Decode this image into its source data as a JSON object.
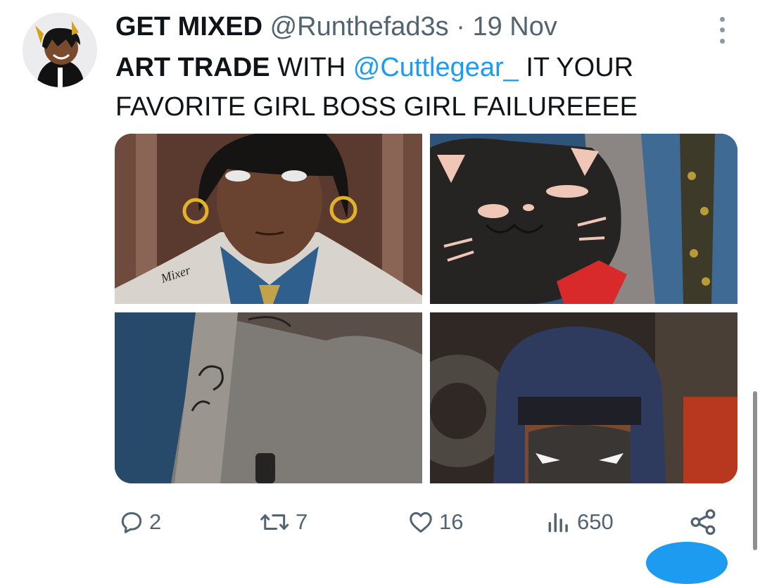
{
  "tweet": {
    "display_name": "GET MIXED",
    "handle": "@Runthefad3s",
    "separator": " · ",
    "date": "19 Nov",
    "text_bold": "ART TRADE",
    "text_part1": " WITH ",
    "mention": "@Cuttlegear_",
    "text_part2": " IT YOUR FAVORITE GIRL BOSS GIRL FAILUREEEE",
    "images": [
      "art-panel-portrait",
      "art-panel-cat",
      "art-panel-jacket",
      "art-panel-figure"
    ],
    "image_signature": "Mixer"
  },
  "actions": {
    "replies": "2",
    "reposts": "7",
    "likes": "16",
    "views": "650"
  },
  "icons": [
    "reply-icon",
    "repost-icon",
    "like-icon",
    "views-icon",
    "share-icon",
    "more-icon"
  ],
  "colors": {
    "accent": "#1d9bf0",
    "muted": "#536471",
    "text": "#0f1419"
  }
}
